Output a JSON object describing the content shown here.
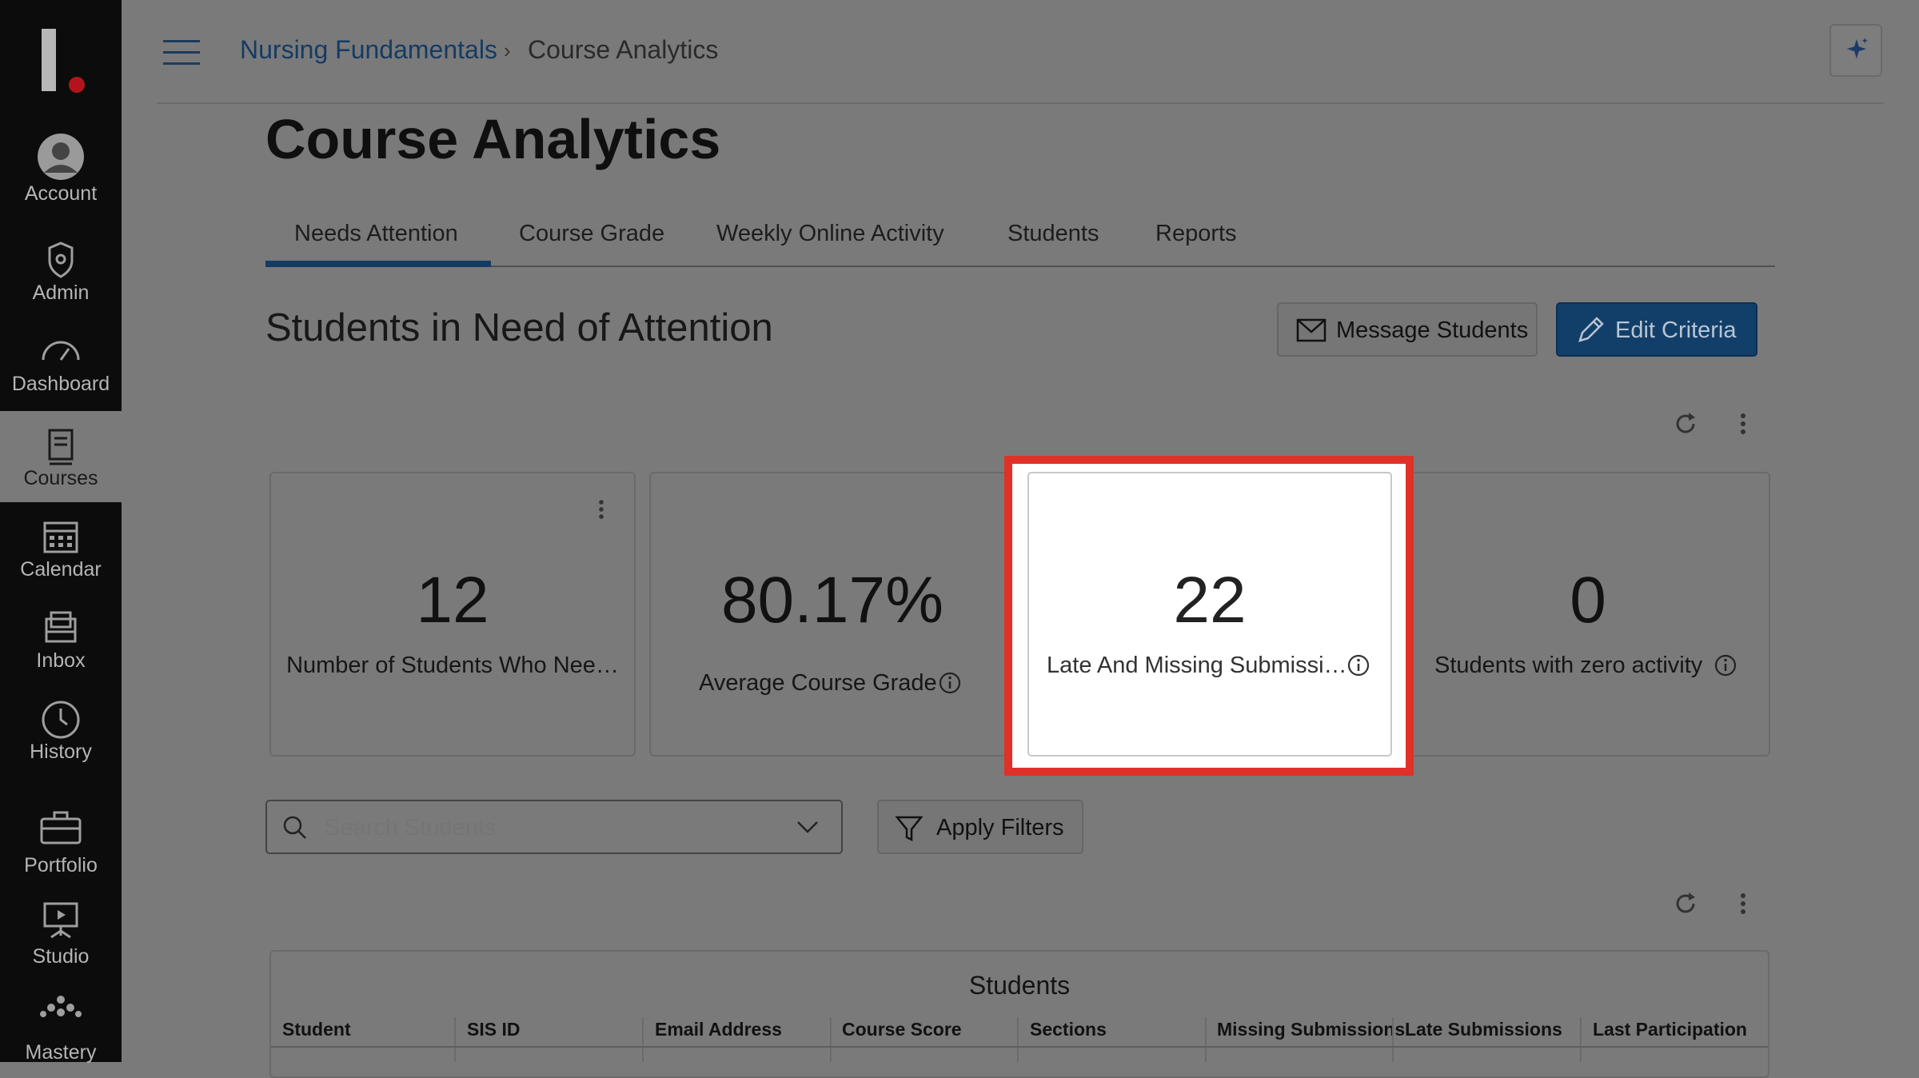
{
  "global_nav": {
    "items": [
      {
        "label": "Account",
        "icon": "account-avatar-icon"
      },
      {
        "label": "Admin",
        "icon": "shield-icon"
      },
      {
        "label": "Dashboard",
        "icon": "speedometer-icon"
      },
      {
        "label": "Courses",
        "icon": "book-icon",
        "active": true
      },
      {
        "label": "Calendar",
        "icon": "calendar-icon"
      },
      {
        "label": "Inbox",
        "icon": "inbox-icon"
      },
      {
        "label": "History",
        "icon": "clock-icon"
      },
      {
        "label": "Portfolio",
        "icon": "briefcase-icon"
      },
      {
        "label": "Studio",
        "icon": "presentation-icon"
      },
      {
        "label": "Mastery",
        "icon": "mastery-dots-icon"
      }
    ]
  },
  "breadcrumb": {
    "course": "Nursing Fundamentals",
    "separator": "›",
    "current": "Course Analytics"
  },
  "page": {
    "title": "Course Analytics"
  },
  "tabs": [
    {
      "label": "Needs Attention",
      "active": true
    },
    {
      "label": "Course Grade"
    },
    {
      "label": "Weekly Online Activity"
    },
    {
      "label": "Students"
    },
    {
      "label": "Reports"
    }
  ],
  "section": {
    "heading": "Students in Need of Attention"
  },
  "actions": {
    "message_students": "Message Students",
    "edit_criteria": "Edit Criteria"
  },
  "cards": [
    {
      "value": "12",
      "caption": "Number of Students Who Nee…"
    },
    {
      "value": "80.17%",
      "caption": "Average Course Grade"
    },
    {
      "value": "22",
      "caption": "Late And Missing Submissi…",
      "highlighted": true
    },
    {
      "value": "0",
      "caption": "Students with zero activity"
    }
  ],
  "search": {
    "placeholder": "Search Students"
  },
  "filter": {
    "label": "Apply Filters"
  },
  "table": {
    "caption": "Students",
    "columns": [
      "Student",
      "SIS ID",
      "Email Address",
      "Course Score",
      "Sections",
      "Missing Submissions",
      "Late Submissions",
      "Last Participation"
    ]
  },
  "colors": {
    "brand_dark_blue": "#143b64",
    "highlight_red": "#e03128",
    "brand_red_dot": "#b3141c"
  }
}
